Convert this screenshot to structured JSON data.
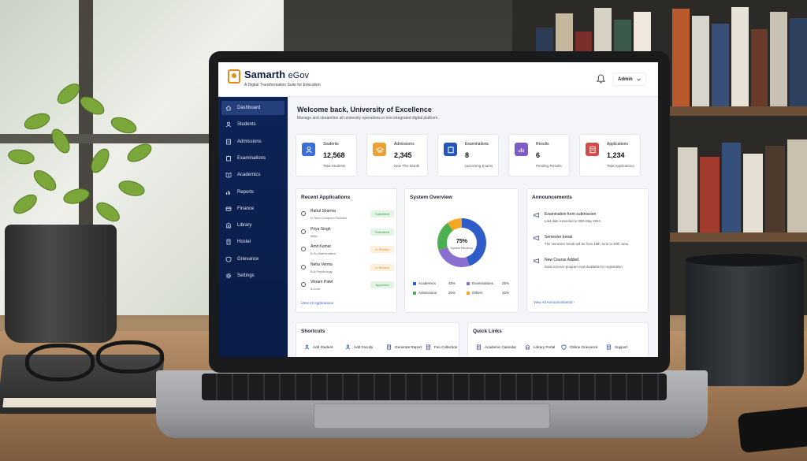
{
  "brand": {
    "name": "Samarth",
    "name_suffix": "eGov",
    "tagline": "A Digital Transformation Suite for Education",
    "accent": "#e48a1f"
  },
  "header": {
    "user": "Admin"
  },
  "sidebar": {
    "items": [
      {
        "label": "Dashboard",
        "icon": "home-icon",
        "active": true
      },
      {
        "label": "Students",
        "icon": "users-icon"
      },
      {
        "label": "Admissions",
        "icon": "document-icon"
      },
      {
        "label": "Examinations",
        "icon": "clipboard-icon"
      },
      {
        "label": "Academics",
        "icon": "book-icon"
      },
      {
        "label": "Reports",
        "icon": "bar-chart-icon"
      },
      {
        "label": "Finance",
        "icon": "credit-card-icon"
      },
      {
        "label": "Library",
        "icon": "library-icon"
      },
      {
        "label": "Hostel",
        "icon": "building-icon"
      },
      {
        "label": "Grievance",
        "icon": "shield-icon"
      },
      {
        "label": "Settings",
        "icon": "gear-icon"
      }
    ]
  },
  "welcome": {
    "title": "Welcome back, University of Excellence",
    "subtitle": "Manage and streamline all university operations in one integrated digital platform."
  },
  "stats": [
    {
      "label": "Students",
      "value": "12,568",
      "sub": "Total Students",
      "color": "#3a6fd8",
      "icon": "users-icon"
    },
    {
      "label": "Admissions",
      "value": "2,345",
      "sub": "New This Month",
      "color": "#f0a030",
      "icon": "graduation-cap-icon"
    },
    {
      "label": "Examinations",
      "value": "8",
      "sub": "Upcoming Exams",
      "color": "#2456b8",
      "icon": "clipboard-icon"
    },
    {
      "label": "Results",
      "value": "6",
      "sub": "Pending Results",
      "color": "#7e5bc7",
      "icon": "chart-icon"
    },
    {
      "label": "Applications",
      "value": "1,234",
      "sub": "Total Applications",
      "color": "#d24a4a",
      "icon": "document-icon"
    }
  ],
  "recent_applications": {
    "title": "Recent Applications",
    "rows": [
      {
        "name": "Rahul Sharma",
        "course": "B.Tech Computer Science",
        "status": "Submitted",
        "status_color": "#3b9b4a",
        "status_bg": "#e4f4e4"
      },
      {
        "name": "Priya Singh",
        "course": "MBA",
        "status": "Submitted",
        "status_color": "#3b9b4a",
        "status_bg": "#e4f4e4"
      },
      {
        "name": "Amit Kumar",
        "course": "B.Sc Mathematics",
        "status": "In Review",
        "status_color": "#d98a1c",
        "status_bg": "#fdf0dc"
      },
      {
        "name": "Neha Verma",
        "course": "B.A Psychology",
        "status": "In Review",
        "status_color": "#d98a1c",
        "status_bg": "#fdf0dc"
      },
      {
        "name": "Vikram Patel",
        "course": "B.Com",
        "status": "Approved",
        "status_color": "#3b9b4a",
        "status_bg": "#e4f4e4"
      }
    ],
    "link": "View All Applications"
  },
  "system_overview": {
    "title": "System Overview",
    "center_value": "75%",
    "center_label": "System Efficiency"
  },
  "chart_data": {
    "type": "pie",
    "categories": [
      "Academics",
      "Examinations",
      "Admissions",
      "Others"
    ],
    "values": [
      45,
      25,
      20,
      10
    ],
    "value_labels": [
      "45%",
      "25%",
      "20%",
      "10%"
    ],
    "colors": [
      "#2e5cc9",
      "#8a6fd1",
      "#4caf50",
      "#f5a623"
    ]
  },
  "announcements": {
    "title": "Announcements",
    "items": [
      {
        "title": "Examination form submission",
        "desc": "Last date extended to 30th May 2024"
      },
      {
        "title": "Semester break",
        "desc": "The semester break will be from 15th June to 30th June."
      },
      {
        "title": "New Course Added",
        "desc": "Data Science program now available for registration."
      }
    ],
    "link": "View All Announcements ›"
  },
  "shortcuts": {
    "title": "Shortcuts",
    "items": [
      "Add Student",
      "Add Faculty",
      "Generate Report",
      "Fee Collection"
    ]
  },
  "quick_links": {
    "title": "Quick Links",
    "items": [
      "Academic Calendar",
      "Library Portal",
      "Online Grievance",
      "Support"
    ]
  }
}
